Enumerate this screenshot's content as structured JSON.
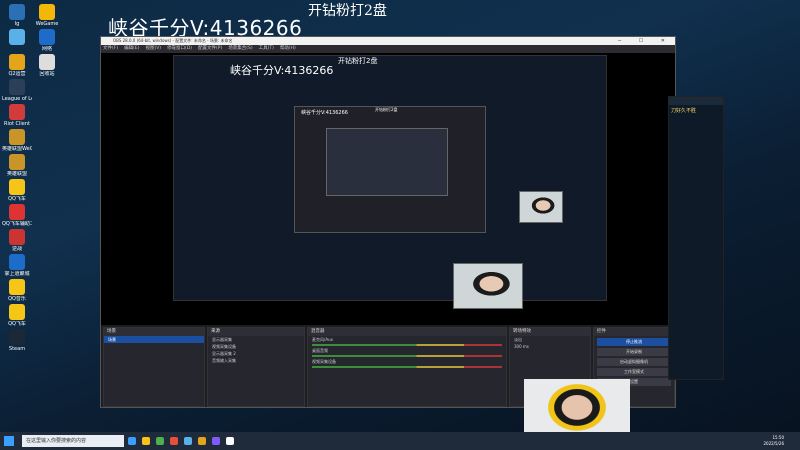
{
  "overlay": {
    "big_text": "峡谷千分V:4136266",
    "top_text": "开钻粉打2盘",
    "nested_text1": "峡谷千分V:4136266",
    "nested_text2": "开钻粉打2盘",
    "nested_text3": "峡谷千分V:4136266",
    "nested_text4": "开钻粉打2盘"
  },
  "desktop_icons": [
    {
      "label": "Ig",
      "color": "#2b6fb5"
    },
    {
      "label": "WeGame",
      "color": "#f3b70a"
    },
    {
      "label": "",
      "color": "#5ab0e8"
    },
    {
      "label": "网络",
      "color": "#1e6cc9"
    },
    {
      "label": "Q2运营",
      "color": "#e3a61a"
    },
    {
      "label": "回收站",
      "color": "#dddddd"
    },
    {
      "label": "League of Legends",
      "color": "#2c3e58"
    },
    {
      "label": "Riot Client",
      "color": "#d13b3b"
    },
    {
      "label": "英雄联盟WeGame版",
      "color": "#c99428"
    },
    {
      "label": "英雄联盟",
      "color": "#c99428"
    },
    {
      "label": "QQ飞车",
      "color": "#f5c518"
    },
    {
      "label": "QQ飞车辅助工具",
      "color": "#d33"
    },
    {
      "label": "逆战",
      "color": "#c33"
    },
    {
      "label": "掌上道聚城",
      "color": "#1e6cc9"
    },
    {
      "label": "QQ音乐",
      "color": "#f5c518"
    },
    {
      "label": "QQ飞车",
      "color": "#f5c518"
    },
    {
      "label": "Steam",
      "color": "#1b2838"
    }
  ],
  "obs": {
    "title": "OBS 28.0.0 (64-bit, windows) - 配置文件: 未命名 - 场景: 未命名",
    "menu": [
      "文件(F)",
      "编辑(E)",
      "视图(V)",
      "停靠窗口(D)",
      "配置文件(P)",
      "场景集合(S)",
      "工具(T)",
      "帮助(H)"
    ],
    "panels": {
      "scenes": {
        "title": "场景",
        "items": [
          "场景"
        ]
      },
      "sources": {
        "title": "来源",
        "items": [
          "显示器采集",
          "视频采集设备",
          "显示器采集 2",
          "音频输入采集"
        ]
      },
      "mixer": {
        "title": "混音器",
        "channels": [
          {
            "name": "麦克风/Aux",
            "db": "-0.1 dB"
          },
          {
            "name": "桌面音频",
            "db": "0.0 dB"
          },
          {
            "name": "视频采集设备",
            "db": "0.0 dB"
          }
        ]
      },
      "transitions": {
        "title": "转场特效",
        "type": "淡出",
        "duration_label": "时长",
        "duration": "300 ms"
      },
      "controls": {
        "title": "控件",
        "buttons": [
          "停止推流",
          "开始录制",
          "启动虚拟摄像机",
          "工作室模式",
          "设置",
          "退出"
        ]
      }
    },
    "status": "LIVE 00:00:00"
  },
  "right_window": {
    "header": "",
    "text": "刀好久不胜"
  },
  "taskbar": {
    "search_placeholder": "在这里输入你要搜索的内容",
    "time": "15:50",
    "date": "2022/5/26",
    "icon_colors": [
      "#3aa0ff",
      "#f5c518",
      "#4caf50",
      "#e94e3c",
      "#5ab0e8",
      "#e3a61a",
      "#7d5cff",
      "#ffffff"
    ]
  }
}
